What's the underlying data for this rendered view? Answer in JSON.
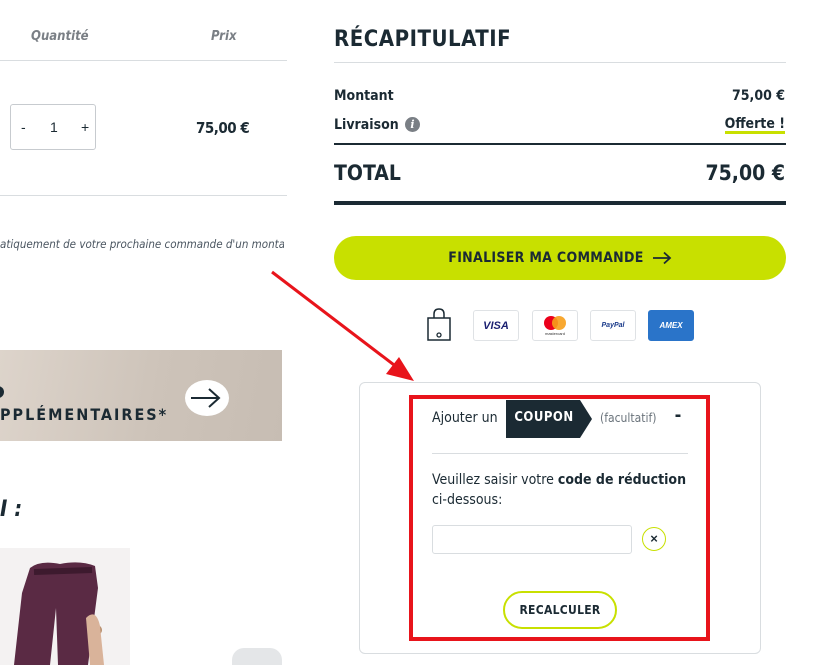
{
  "cart": {
    "col_quantity": "Quantité",
    "col_price": "Prix",
    "stepper": {
      "minus": "-",
      "value": "1",
      "plus": "+"
    },
    "line_price": "75,00 €",
    "note": "atiquement de votre prochaine commande d'un montant",
    "banner_text": "PPLÉMENTAIRES*",
    "section_title": "I :"
  },
  "summary": {
    "title": "RÉCAPITULATIF",
    "amount_label": "Montant",
    "amount_value": "75,00 €",
    "shipping_label": "Livraison",
    "shipping_value": "Offerte !",
    "total_label": "TOTAL",
    "total_value": "75,00 €",
    "checkout_label": "FINALISER MA COMMANDE",
    "payment_methods": [
      "VISA",
      "mastercard",
      "PayPal",
      "AMEX"
    ]
  },
  "coupon": {
    "prefix": "Ajouter un",
    "tag": "COUPON",
    "optional": "(facultatif)",
    "collapse": "-",
    "desc_start": "Veuillez saisir votre ",
    "desc_bold": "code de réduction",
    "desc_end": "ci-dessous:",
    "input_value": "",
    "clear": "×",
    "recalc_label": "RECALCULER"
  },
  "colors": {
    "accent": "#c8e000",
    "dark": "#1b2a33",
    "annotation": "#e8141b"
  }
}
